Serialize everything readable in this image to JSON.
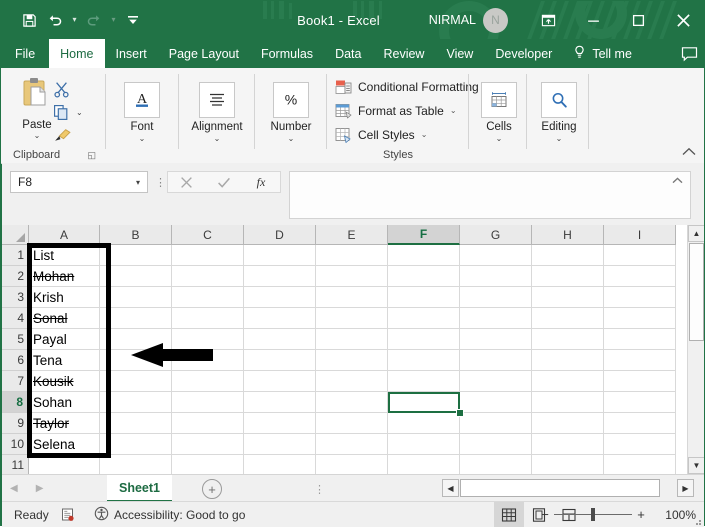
{
  "window": {
    "title": "Book1  -  Excel",
    "account_name": "NIRMAL",
    "avatar_initial": "N",
    "quick_access": [
      {
        "name": "save-icon",
        "label": "Save"
      },
      {
        "name": "undo-icon",
        "label": "Undo"
      },
      {
        "name": "redo-icon",
        "label": "Redo"
      },
      {
        "name": "customize-quick-access-toolbar-icon",
        "label": "Customize Quick Access Toolbar"
      }
    ],
    "controls": [
      {
        "name": "ribbon-display-options-icon",
        "label": "Ribbon Display Options"
      },
      {
        "name": "minimize-icon",
        "label": "Minimize"
      },
      {
        "name": "maximize-icon",
        "label": "Maximize"
      },
      {
        "name": "close-icon",
        "label": "Close"
      }
    ]
  },
  "ribbon": {
    "tabs": [
      {
        "label": "File",
        "active": false
      },
      {
        "label": "Home",
        "active": true
      },
      {
        "label": "Insert",
        "active": false
      },
      {
        "label": "Page Layout",
        "active": false
      },
      {
        "label": "Formulas",
        "active": false
      },
      {
        "label": "Data",
        "active": false
      },
      {
        "label": "Review",
        "active": false
      },
      {
        "label": "View",
        "active": false
      },
      {
        "label": "Developer",
        "active": false
      }
    ],
    "tell_me": "Tell me",
    "groups": {
      "clipboard": {
        "label": "Clipboard",
        "paste_label": "Paste",
        "items": [
          "Cut",
          "Copy",
          "Format Painter"
        ]
      },
      "font": {
        "label": "Font"
      },
      "alignment": {
        "label": "Alignment"
      },
      "number": {
        "label": "Number"
      },
      "styles": {
        "label": "Styles",
        "items": [
          {
            "label": "Conditional Formatting"
          },
          {
            "label": "Format as Table"
          },
          {
            "label": "Cell Styles"
          }
        ]
      },
      "cells": {
        "label": "Cells"
      },
      "editing": {
        "label": "Editing"
      }
    }
  },
  "formula_bar": {
    "name_box_value": "F8",
    "formula_value": "",
    "cancel_label": "Cancel",
    "enter_label": "Enter",
    "insert_function_label": "fx"
  },
  "sheet": {
    "columns": [
      "A",
      "B",
      "C",
      "D",
      "E",
      "F",
      "G",
      "H",
      "I"
    ],
    "selected_column": "F",
    "rows": [
      "1",
      "2",
      "3",
      "4",
      "5",
      "6",
      "7",
      "8",
      "9",
      "10",
      "11"
    ],
    "selected_row": "8",
    "selected_cell": "F8",
    "column_a_values": [
      {
        "row": "1",
        "value": "List",
        "strikethrough": false
      },
      {
        "row": "2",
        "value": "Mohan",
        "strikethrough": true
      },
      {
        "row": "3",
        "value": "Krish",
        "strikethrough": false
      },
      {
        "row": "4",
        "value": "Sonal",
        "strikethrough": true
      },
      {
        "row": "5",
        "value": "Payal",
        "strikethrough": false
      },
      {
        "row": "6",
        "value": "Tena",
        "strikethrough": false
      },
      {
        "row": "7",
        "value": "Kousik",
        "strikethrough": true
      },
      {
        "row": "8",
        "value": "Sohan",
        "strikethrough": false
      },
      {
        "row": "9",
        "value": "Taylor",
        "strikethrough": true
      },
      {
        "row": "10",
        "value": "Selena",
        "strikethrough": false
      }
    ],
    "annotation": {
      "type": "arrow",
      "direction": "left",
      "points_at": "A1:A10"
    }
  },
  "sheet_tabs": {
    "tabs": [
      {
        "label": "Sheet1",
        "active": true
      }
    ],
    "add_sheet_label": "+"
  },
  "status_bar": {
    "mode": "Ready",
    "accessibility": "Accessibility: Good to go",
    "views": [
      {
        "name": "normal-view-icon",
        "label": "Normal",
        "active": true
      },
      {
        "name": "page-layout-view-icon",
        "label": "Page Layout",
        "active": false
      },
      {
        "name": "page-break-preview-icon",
        "label": "Page Break Preview",
        "active": false
      }
    ],
    "zoom_out_label": "−",
    "zoom_in_label": "+",
    "zoom_level": "100%"
  },
  "colors": {
    "excel_green": "#217346",
    "selection_green": "#1d6f42",
    "ribbon_bg": "#f5f5f5"
  }
}
